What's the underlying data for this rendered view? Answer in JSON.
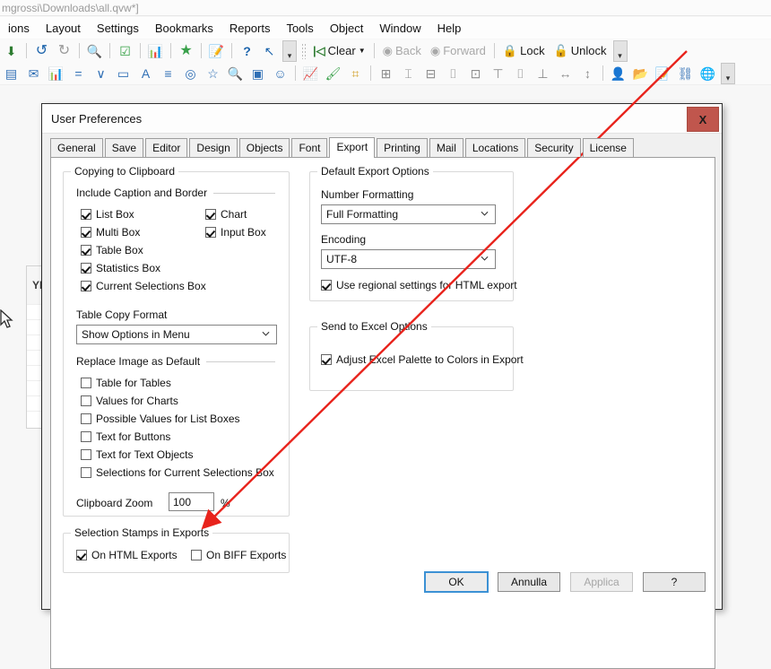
{
  "app": {
    "titlebar_text": "mgrossi\\Downloads\\all.qvw*]",
    "menu": [
      {
        "label": "ions"
      },
      {
        "label": "Layout"
      },
      {
        "label": "Settings"
      },
      {
        "label": "Bookmarks"
      },
      {
        "label": "Reports"
      },
      {
        "label": "Tools"
      },
      {
        "label": "Object"
      },
      {
        "label": "Window"
      },
      {
        "label": "Help"
      }
    ],
    "toolbar_row1": {
      "icons": [
        {
          "name": "export-to-excel-icon",
          "glyph": "⬇"
        },
        {
          "name": "undo-icon",
          "glyph": "↶"
        },
        {
          "name": "redo-icon",
          "glyph": "↷"
        },
        {
          "name": "search-icon",
          "glyph": "🔍"
        },
        {
          "name": "select-possible-icon",
          "glyph": "☑"
        },
        {
          "name": "quick-chart-icon",
          "glyph": "📊"
        },
        {
          "name": "add-bookmark-icon",
          "glyph": "★"
        },
        {
          "name": "edit-script-icon",
          "glyph": "📝"
        },
        {
          "name": "help-icon",
          "glyph": "?"
        },
        {
          "name": "context-help-icon",
          "glyph": "↖"
        }
      ],
      "clear_label": "Clear",
      "back_label": "Back",
      "forward_label": "Forward",
      "lock_label": "Lock",
      "unlock_label": "Unlock"
    },
    "toolbar_row2": {
      "icons": [
        {
          "name": "table-box-icon",
          "glyph": "▤"
        },
        {
          "name": "pivot-table-icon",
          "glyph": "✉"
        },
        {
          "name": "bar-chart-icon",
          "glyph": "📊"
        },
        {
          "name": "statistics-box-icon",
          "glyph": "="
        },
        {
          "name": "multi-box-icon",
          "glyph": "∨"
        },
        {
          "name": "button-object-icon",
          "glyph": "▭"
        },
        {
          "name": "text-object-icon",
          "glyph": "A"
        },
        {
          "name": "list-box-icon",
          "glyph": "≡"
        },
        {
          "name": "slider-object-icon",
          "glyph": "◎"
        },
        {
          "name": "bookmark-object-icon",
          "glyph": "☆"
        },
        {
          "name": "search-object-icon",
          "glyph": "🔍"
        },
        {
          "name": "container-object-icon",
          "glyph": "▣"
        },
        {
          "name": "custom-object-icon",
          "glyph": "☺"
        },
        {
          "name": "chart-wizard-icon",
          "glyph": "📈"
        },
        {
          "name": "format-painter-icon",
          "glyph": "🖌"
        },
        {
          "name": "grid-icon",
          "glyph": "⌗"
        },
        {
          "name": "align-left-icon",
          "glyph": "⊞"
        },
        {
          "name": "align-center-icon",
          "glyph": "⌶"
        },
        {
          "name": "align-right-icon",
          "glyph": "⊟"
        },
        {
          "name": "distribute-horizontal-icon",
          "glyph": "⌷"
        },
        {
          "name": "distribute-vertical-icon",
          "glyph": "⊡"
        },
        {
          "name": "align-top-icon",
          "glyph": "⊤"
        },
        {
          "name": "align-middle-icon",
          "glyph": "⌷"
        },
        {
          "name": "align-bottom-icon",
          "glyph": "⊥"
        },
        {
          "name": "space-horizontal-icon",
          "glyph": "↔"
        },
        {
          "name": "space-vertical-icon",
          "glyph": "↕"
        },
        {
          "name": "user-icon",
          "glyph": "👤"
        },
        {
          "name": "open-document-icon",
          "glyph": "📂"
        },
        {
          "name": "edit-document-icon",
          "glyph": "📝"
        },
        {
          "name": "share-icon",
          "glyph": "⛓"
        },
        {
          "name": "publish-web-icon",
          "glyph": "🌐"
        }
      ]
    }
  },
  "background_listbox": {
    "caption": "YR"
  },
  "dialog": {
    "title": "User Preferences",
    "close_label": "X",
    "tabs": [
      {
        "label": "General",
        "active": false
      },
      {
        "label": "Save",
        "active": false
      },
      {
        "label": "Editor",
        "active": false
      },
      {
        "label": "Design",
        "active": false
      },
      {
        "label": "Objects",
        "active": false
      },
      {
        "label": "Font",
        "active": false
      },
      {
        "label": "Export",
        "active": true
      },
      {
        "label": "Printing",
        "active": false
      },
      {
        "label": "Mail",
        "active": false
      },
      {
        "label": "Locations",
        "active": false
      },
      {
        "label": "Security",
        "active": false
      },
      {
        "label": "License",
        "active": false
      }
    ],
    "copying_to_clipboard": {
      "group_title": "Copying to Clipboard",
      "include_caption_and_border": {
        "heading": "Include Caption and Border",
        "checkboxes_left": [
          {
            "label": "List Box",
            "checked": true
          },
          {
            "label": "Multi Box",
            "checked": true
          },
          {
            "label": "Table Box",
            "checked": true
          },
          {
            "label": "Statistics Box",
            "checked": true
          },
          {
            "label": "Current Selections Box",
            "checked": true
          }
        ],
        "checkboxes_right": [
          {
            "label": "Chart",
            "checked": true
          },
          {
            "label": "Input Box",
            "checked": true
          }
        ]
      },
      "table_copy_format": {
        "label": "Table Copy Format",
        "value": "Show Options in Menu"
      },
      "replace_image_as_default": {
        "heading": "Replace Image as Default",
        "checkboxes": [
          {
            "label": "Table for Tables",
            "checked": false
          },
          {
            "label": "Values for Charts",
            "checked": false
          },
          {
            "label": "Possible Values for List Boxes",
            "checked": false
          },
          {
            "label": "Text for Buttons",
            "checked": false
          },
          {
            "label": "Text for Text Objects",
            "checked": false
          },
          {
            "label": "Selections for Current Selections Box",
            "checked": false
          }
        ]
      },
      "clipboard_zoom": {
        "label": "Clipboard Zoom",
        "value": "100",
        "unit": "%"
      }
    },
    "selection_stamps": {
      "group_title": "Selection Stamps in Exports",
      "checkboxes": [
        {
          "label": "On HTML Exports",
          "checked": true
        },
        {
          "label": "On BIFF Exports",
          "checked": false
        }
      ]
    },
    "default_export_options": {
      "group_title": "Default Export Options",
      "number_formatting": {
        "label": "Number Formatting",
        "value": "Full Formatting"
      },
      "encoding": {
        "label": "Encoding",
        "value": "UTF-8"
      },
      "use_regional": {
        "label": "Use regional settings for HTML export",
        "checked": true
      }
    },
    "send_to_excel_options": {
      "group_title": "Send to Excel Options",
      "adjust_palette": {
        "label": "Adjust Excel Palette to Colors in Export",
        "checked": true
      }
    },
    "buttons": [
      {
        "label": "OK",
        "state": "focus"
      },
      {
        "label": "Annulla",
        "state": "normal"
      },
      {
        "label": "Applica",
        "state": "disabled"
      },
      {
        "label": "?",
        "state": "normal"
      }
    ]
  },
  "annotation": {
    "arrow_color": "#e8231c"
  }
}
